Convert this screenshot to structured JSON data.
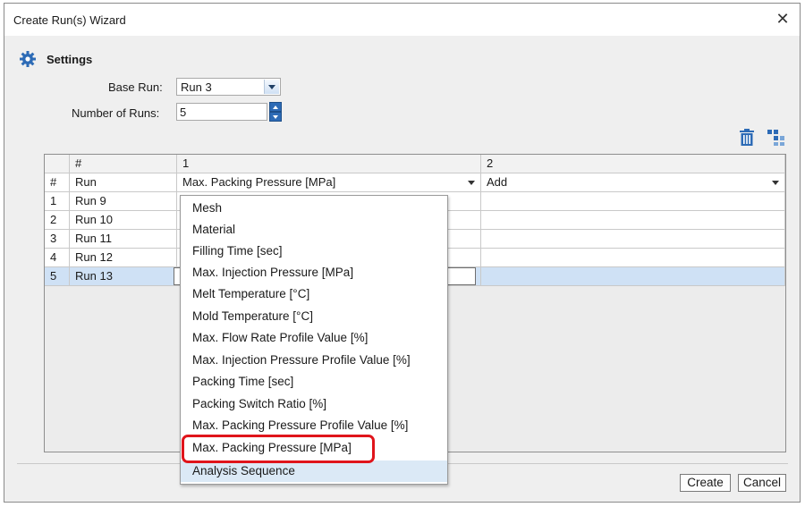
{
  "window": {
    "title": "Create Run(s) Wizard",
    "close_glyph": "✕"
  },
  "settings": {
    "header": "Settings",
    "icon": "gear-icon",
    "base_run_label": "Base Run:",
    "base_run_value": "Run 3",
    "num_runs_label": "Number of Runs:",
    "num_runs_value": "5"
  },
  "toolbar": {
    "delete_icon": "trash-icon",
    "table_icon": "table-settings-icon"
  },
  "grid": {
    "header_row": {
      "c0": "",
      "c1": "#",
      "c2": "1",
      "c3": "2"
    },
    "param_row": {
      "c0": "#",
      "c1": "Run",
      "c2": "Max. Packing Pressure [MPa]",
      "c3": "Add"
    },
    "rows": [
      {
        "num": "1",
        "run": "Run 9"
      },
      {
        "num": "2",
        "run": "Run 10"
      },
      {
        "num": "3",
        "run": "Run 11"
      },
      {
        "num": "4",
        "run": "Run 12"
      },
      {
        "num": "5",
        "run": "Run 13"
      }
    ]
  },
  "dropdown": {
    "items": [
      "Mesh",
      "Material",
      "Filling Time [sec]",
      "Max. Injection Pressure [MPa]",
      "Melt Temperature [°C]",
      "Mold Temperature [°C]",
      "Max. Flow Rate Profile Value [%]",
      "Max. Injection Pressure Profile Value [%]",
      "Packing Time [sec]",
      "Packing Switch Ratio [%]",
      "Max. Packing Pressure Profile Value [%]",
      "Max. Packing Pressure [MPa]",
      "Analysis Sequence"
    ],
    "highlight_color": "#e0141b"
  },
  "buttons": {
    "create": "Create",
    "cancel": "Cancel"
  },
  "colors": {
    "accent": "#2d6bb6",
    "selection": "#cfe1f5",
    "client_bg": "#efefef"
  }
}
